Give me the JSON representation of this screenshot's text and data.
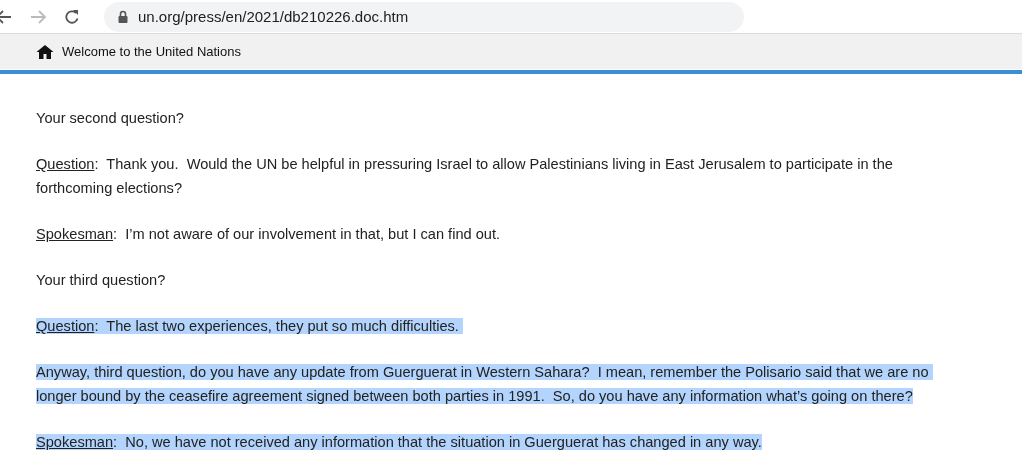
{
  "browser": {
    "url": "un.org/press/en/2021/db210226.doc.htm",
    "forward_disabled": true
  },
  "bookmarks_bar": {
    "label": "Welcome to the United Nations"
  },
  "paragraphs": [
    {
      "text": "Your second question?",
      "selected": false
    },
    {
      "speaker": "Question",
      "text": ":  Thank you.  Would the UN be helpful in pressuring Israel to allow Palestinians living in East Jerusalem to participate in the forthcoming elections?",
      "selected": false
    },
    {
      "speaker": "Spokesman",
      "text": ":  I’m not aware of our involvement in that, but I can find out.",
      "selected": false
    },
    {
      "text": "Your third question?",
      "selected": false
    },
    {
      "speaker": "Question",
      "text": ":  The last two experiences, they put so much difficulties. ",
      "selected": true
    },
    {
      "text": "Anyway, third question, do you have any update from Guerguerat in Western Sahara?  I mean, remember the Polisario said that we are no longer bound by the ceasefire agreement signed between both parties in 1991.  So, do you have any information what’s going on there?",
      "selected": true
    },
    {
      "speaker": "Spokesman",
      "text": ":  No, we have not received any information that the situation in Guerguerat has changed in any way.",
      "selected": true
    }
  ]
}
